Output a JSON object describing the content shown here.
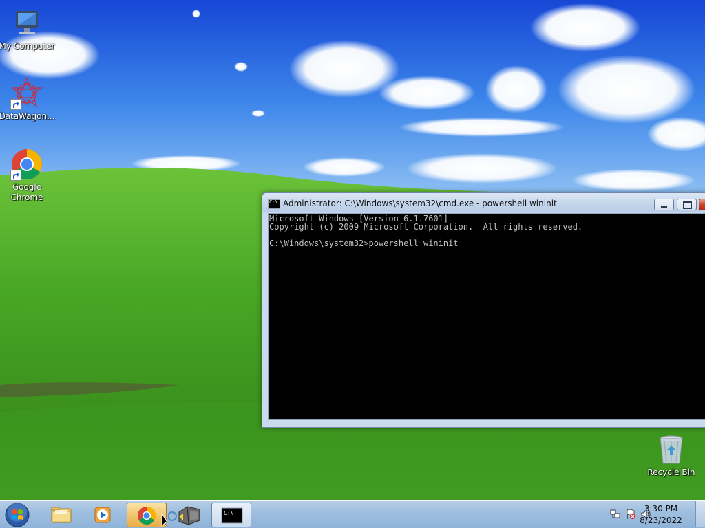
{
  "desktop": {
    "icons": [
      {
        "label": "My Computer",
        "icon": "computer-icon"
      },
      {
        "label": "DataWagon...",
        "icon": "datawagon-icon"
      },
      {
        "label": "Google Chrome",
        "icon": "chrome-icon"
      },
      {
        "label": "Recycle Bin",
        "icon": "recycle-bin-icon"
      }
    ]
  },
  "console_window": {
    "title": "Administrator: C:\\Windows\\system32\\cmd.exe - powershell  wininit",
    "icon_text": "C:\\.",
    "lines": [
      "Microsoft Windows [Version 6.1.7601]",
      "Copyright (c) 2009 Microsoft Corporation.  All rights reserved.",
      "",
      "C:\\Windows\\system32>powershell wininit"
    ]
  },
  "taskbar": {
    "buttons": [
      {
        "name": "start",
        "icon": "windows-logo-icon"
      },
      {
        "name": "explorer",
        "icon": "folder-icon"
      },
      {
        "name": "media-player",
        "icon": "media-player-icon"
      },
      {
        "name": "chrome",
        "icon": "chrome-icon",
        "state": "active"
      },
      {
        "name": "app",
        "icon": "app-icon"
      },
      {
        "name": "cmd",
        "icon": "cmd-icon",
        "state": "running",
        "icon_text": "C:\\_"
      }
    ],
    "clock": {
      "time": "3:30 PM",
      "date": "8/23/2022"
    }
  },
  "colors": {
    "sky_top": "#1a4fd8",
    "grass": "#3f9a1e",
    "console_bg": "#000000",
    "console_text": "#c0c0c0",
    "active_task": "#f0c46a"
  }
}
